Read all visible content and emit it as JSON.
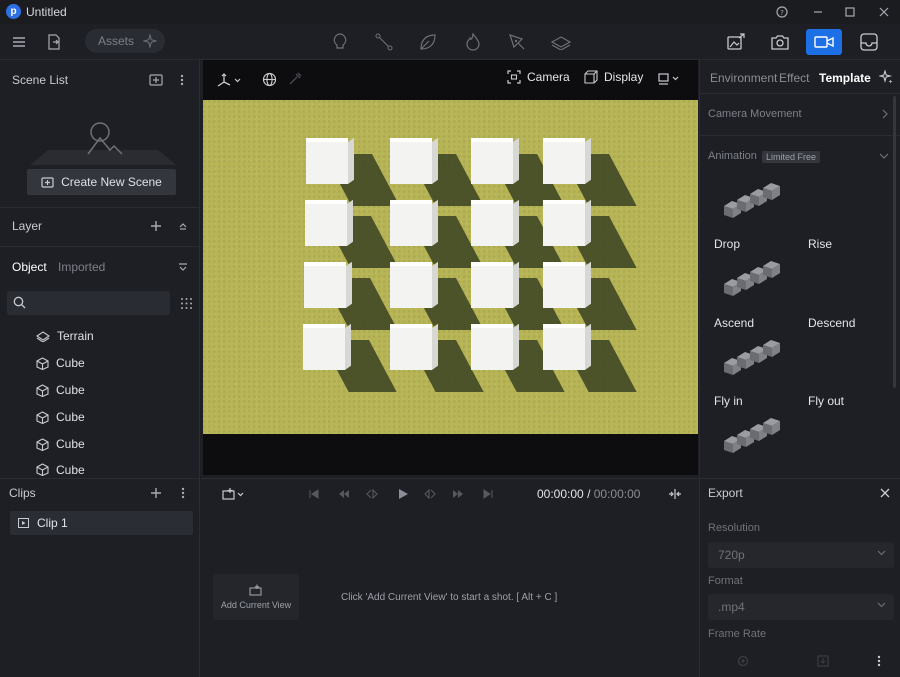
{
  "window": {
    "title": "Untitled",
    "logo_letter": "p"
  },
  "toolbar": {
    "assets_label": "Assets"
  },
  "scene_list": {
    "title": "Scene List",
    "create_button": "Create New Scene"
  },
  "layer": {
    "title": "Layer"
  },
  "object_panel": {
    "tabs": [
      "Object",
      "Imported"
    ],
    "items": [
      "Terrain",
      "Cube",
      "Cube",
      "Cube",
      "Cube",
      "Cube"
    ]
  },
  "viewport": {
    "camera_label": "Camera",
    "display_label": "Display",
    "colors": {
      "ground": "#b7b555",
      "cube": "#f3f3f1",
      "shadow": "#3a4222"
    }
  },
  "right_panel": {
    "tabs": [
      "Environment",
      "Effect",
      "Template"
    ],
    "active_tab": "Template",
    "camera_movement_label": "Camera Movement",
    "animation_label": "Animation",
    "limited_badge": "Limited Free",
    "animations": [
      "Drop",
      "Rise",
      "Ascend",
      "Descend",
      "Fly in",
      "Fly out"
    ]
  },
  "clips": {
    "title": "Clips",
    "items": [
      "Clip 1"
    ]
  },
  "timeline": {
    "current_time": "00:00:00",
    "separator": "/",
    "total_time": "00:00:00",
    "add_view_label": "Add Current View",
    "hint": "Click 'Add Current View' to start a shot. [ Alt + C ]"
  },
  "export": {
    "title": "Export",
    "resolution_label": "Resolution",
    "resolution_value": "720p",
    "format_label": "Format",
    "format_value": ".mp4",
    "frame_rate_label": "Frame Rate"
  },
  "theme": {
    "accent": "#1d6fe6",
    "background": "#1e1f24"
  }
}
